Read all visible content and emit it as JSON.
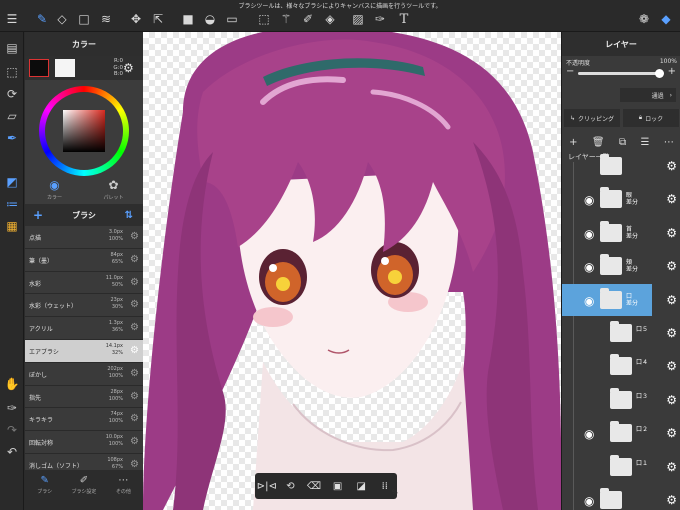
{
  "topbar": {
    "message": "ブラシツールは、様々なブラシによりキャンバスに描画を行うツールです。"
  },
  "color_panel": {
    "title": "カラー",
    "rgb": [
      "R:0",
      "G:0",
      "B:0"
    ],
    "tabs": [
      {
        "label": "カラー",
        "active": true
      },
      {
        "label": "パレット",
        "active": false
      }
    ]
  },
  "brush_panel": {
    "title": "ブラシ",
    "brushes": [
      {
        "name": "点描",
        "size": "3.0px",
        "opacity": "100%"
      },
      {
        "name": "筆（墨）",
        "size": "84px",
        "opacity": "65%"
      },
      {
        "name": "水彩",
        "size": "11.0px",
        "opacity": "50%"
      },
      {
        "name": "水彩（ウェット）",
        "size": "23px",
        "opacity": "30%"
      },
      {
        "name": "アクリル",
        "size": "1.3px",
        "opacity": "36%"
      },
      {
        "name": "エアブラシ",
        "size": "14.1px",
        "opacity": "32%",
        "selected": true
      },
      {
        "name": "ぼかし",
        "size": "202px",
        "opacity": "100%"
      },
      {
        "name": "指先",
        "size": "28px",
        "opacity": "100%"
      },
      {
        "name": "キラキラ",
        "size": "74px",
        "opacity": "100%"
      },
      {
        "name": "回転対称",
        "size": "10.0px",
        "opacity": "100%"
      },
      {
        "name": "消しゴム（ソフト）",
        "size": "108px",
        "opacity": "67%"
      }
    ],
    "bottom_tabs": [
      {
        "label": "ブラシ",
        "active": true
      },
      {
        "label": "ブラシ設定",
        "active": false
      },
      {
        "label": "その他",
        "active": false
      }
    ]
  },
  "canvas": {
    "zoom_fragment": "%"
  },
  "layer_panel": {
    "title": "レイヤー",
    "opacity_label": "不透明度",
    "opacity_value": "100%",
    "opacity_fraction": 1.0,
    "blend_mode": "通過",
    "clipping_label": "クリッピング",
    "lock_label": "ロック",
    "list_title": "レイヤー一覧",
    "layers": [
      {
        "name": "",
        "visible": false,
        "indent": 1,
        "selected": false
      },
      {
        "name": "眼\n差分",
        "visible": true,
        "indent": 1,
        "selected": false
      },
      {
        "name": "首\n差分",
        "visible": true,
        "indent": 1,
        "selected": false
      },
      {
        "name": "頬\n差分",
        "visible": true,
        "indent": 1,
        "selected": false
      },
      {
        "name": "口\n差分",
        "visible": true,
        "indent": 1,
        "selected": true
      },
      {
        "name": "口５",
        "visible": false,
        "indent": 2,
        "selected": false
      },
      {
        "name": "口４",
        "visible": false,
        "indent": 2,
        "selected": false
      },
      {
        "name": "口３",
        "visible": false,
        "indent": 2,
        "selected": false
      },
      {
        "name": "口２",
        "visible": true,
        "indent": 2,
        "selected": false
      },
      {
        "name": "口１",
        "visible": false,
        "indent": 2,
        "selected": false
      },
      {
        "name": "",
        "visible": true,
        "indent": 1,
        "selected": false
      }
    ]
  },
  "colors": {
    "accent": "#5aa0ff",
    "selected_layer": "#5ca3dc",
    "primary_color": "#0c0c0c",
    "secondary_color": "#f5f5f5",
    "hair": "#a8428a"
  }
}
